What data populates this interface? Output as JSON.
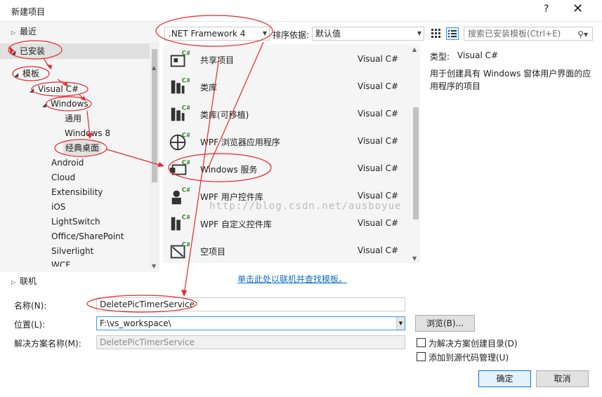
{
  "window": {
    "title": "新建项目",
    "help": "?",
    "close": "✕"
  },
  "tree": {
    "recent": "最近",
    "installed": "已安装",
    "templates": "模板",
    "visual_csharp": "Visual C#",
    "windows": "Windows",
    "general": "通用",
    "windows8": "Windows 8",
    "classic_desktop": "经典桌面",
    "others": [
      "Android",
      "Cloud",
      "Extensibility",
      "iOS",
      "LightSwitch",
      "Office/SharePoint",
      "Silverlight",
      "WCF"
    ],
    "online": "联机"
  },
  "toolbar": {
    "framework": ".NET Framework 4",
    "sort_label": "排序依据:",
    "sort_value": "默认值",
    "search_placeholder": "搜索已安装模板(Ctrl+E)"
  },
  "templates": [
    {
      "name": "共享项目",
      "lang": "Visual C#",
      "icon": "shared-project-icon"
    },
    {
      "name": "类库",
      "lang": "Visual C#",
      "icon": "class-library-icon"
    },
    {
      "name": "类库(可移植)",
      "lang": "Visual C#",
      "icon": "portable-library-icon"
    },
    {
      "name": "WPF 浏览器应用程序",
      "lang": "Visual C#",
      "icon": "wpf-browser-icon"
    },
    {
      "name": "Windows 服务",
      "lang": "Visual C#",
      "icon": "windows-service-icon"
    },
    {
      "name": "WPF 用户控件库",
      "lang": "Visual C#",
      "icon": "wpf-user-control-icon"
    },
    {
      "name": "WPF 自定义控件库",
      "lang": "Visual C#",
      "icon": "wpf-custom-control-icon"
    },
    {
      "name": "空项目",
      "lang": "Visual C#",
      "icon": "empty-project-icon"
    }
  ],
  "details": {
    "type_label": "类型:",
    "type_value": "Visual C#",
    "description": "用于创建具有 Windows 窗体用户界面的应用程序的项目"
  },
  "online_link": "单击此处以联机并查找模板。",
  "form": {
    "name_label": "名称(N):",
    "name_value": "DeletePicTimerService",
    "location_label": "位置(L):",
    "location_value": "F:\\vs_workspace\\",
    "solution_label": "解决方案名称(M):",
    "solution_value": "DeletePicTimerService",
    "browse": "浏览(B)...",
    "create_dir": "为解决方案创建目录(D)",
    "add_source_control": "添加到源代码管理(U)",
    "ok": "确定",
    "cancel": "取消"
  },
  "watermark": "http://blog.csdn.net/ausboyue",
  "colors": {
    "annotation_red": "#e8272b",
    "accent_blue": "#0078d7",
    "link_blue": "#0e70c0",
    "csharp_green": "#388a34"
  }
}
